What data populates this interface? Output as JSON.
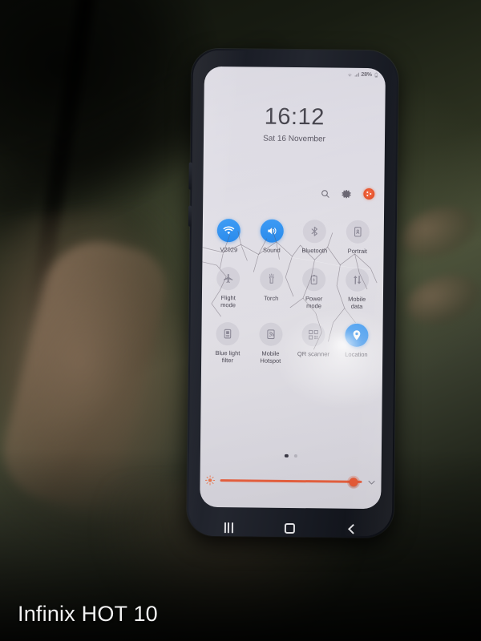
{
  "scene": {
    "watermark_brand": "Infinix",
    "watermark_model": "HOT 10"
  },
  "phone": {
    "status_bar": {
      "battery_percent": "28%"
    },
    "lock_clock": {
      "time": "16:12",
      "date": "Sat 16 November"
    },
    "header_icons": [
      {
        "name": "search-icon",
        "label": "Search"
      },
      {
        "name": "gear-icon",
        "label": "Settings"
      },
      {
        "name": "more-options-icon",
        "label": "More options"
      }
    ],
    "quick_settings": {
      "tiles": [
        {
          "label": "V2029",
          "icon": "wifi-icon",
          "state": "on"
        },
        {
          "label": "Sound",
          "icon": "sound-icon",
          "state": "on"
        },
        {
          "label": "Bluetooth",
          "icon": "bluetooth-icon",
          "state": "off"
        },
        {
          "label": "Portrait",
          "icon": "portrait-icon",
          "state": "off"
        },
        {
          "label": "Flight\nmode",
          "icon": "airplane-icon",
          "state": "off"
        },
        {
          "label": "Torch",
          "icon": "torch-icon",
          "state": "off"
        },
        {
          "label": "Power\nmode",
          "icon": "power-mode-icon",
          "state": "off"
        },
        {
          "label": "Mobile\ndata",
          "icon": "mobile-data-icon",
          "state": "off"
        },
        {
          "label": "Blue light\nfilter",
          "icon": "blue-light-icon",
          "state": "off"
        },
        {
          "label": "Mobile\nHotspot",
          "icon": "hotspot-icon",
          "state": "off"
        },
        {
          "label": "QR scanner",
          "icon": "qr-scanner-icon",
          "state": "off"
        },
        {
          "label": "Location",
          "icon": "location-pin-icon",
          "state": "on"
        }
      ],
      "page_indicator": {
        "total": 2,
        "active": 1
      }
    },
    "brightness": {
      "value_percent": 97,
      "left_icon": "brightness-sun-icon",
      "expand_icon": "chevron-down-icon"
    },
    "navigation_bar": [
      {
        "name": "recents-button",
        "label": "Recents"
      },
      {
        "name": "home-button",
        "label": "Home"
      },
      {
        "name": "back-button",
        "label": "Back"
      }
    ]
  },
  "colors": {
    "tile_active": "#2f90ef",
    "slider_accent": "#eb6240",
    "badge": "#e8562f",
    "screen_bg": "#e0dee6"
  }
}
